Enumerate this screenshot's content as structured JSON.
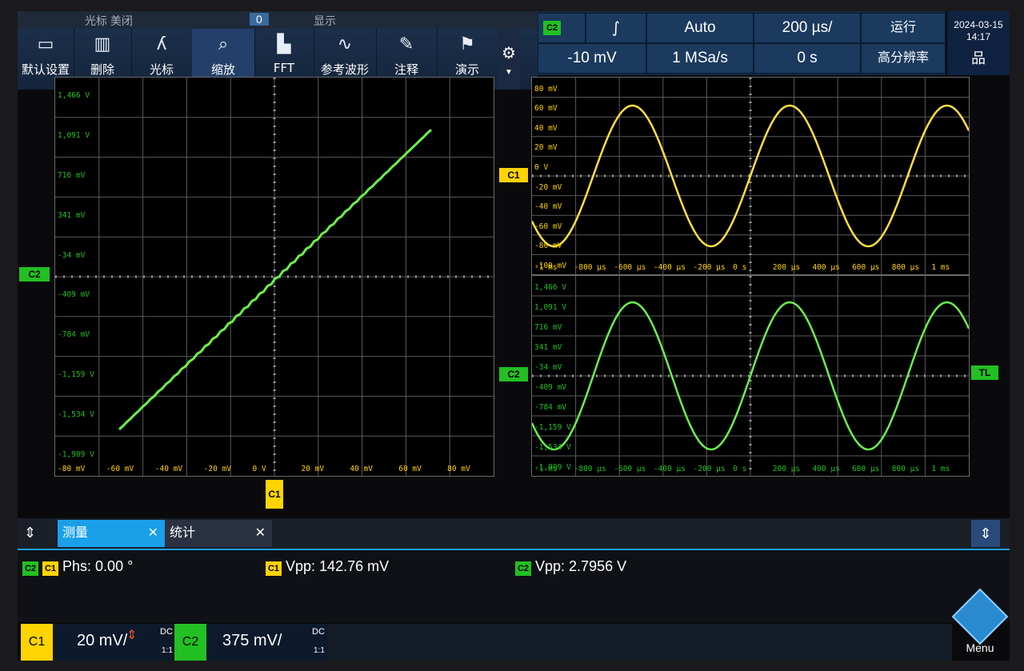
{
  "top_fragment": {
    "left": "光标 美闭",
    "box": "0",
    "mid": "显示"
  },
  "toolbar": {
    "buttons": [
      "默认设置",
      "删除",
      "光标",
      "缩放",
      "FFT",
      "参考波形",
      "注释",
      "演示"
    ]
  },
  "header": {
    "trigger_source": "C2",
    "trigger_level": "-10 mV",
    "trigger_mode": "Auto",
    "sample_rate": "1 MSa/s",
    "timebase": "200 µs/",
    "horizontal_position": "0 s",
    "run_status": "运行",
    "acquire_mode": "高分辨率",
    "date": "2024-03-15",
    "time": "14:17"
  },
  "colors": {
    "c1": "#ffd400",
    "c2": "#22c022",
    "accent": "#1aa0e8",
    "grid": "#5a5a5a"
  },
  "markers": {
    "c1": "C1",
    "c2": "C2",
    "trigger": "TL"
  },
  "xy_plot": {
    "y_labels": [
      "1,466 V",
      "1,091 V",
      "716 mV",
      "341 mV",
      "-34 mV",
      "-409 mV",
      "-784 mV",
      "-1,159 V",
      "-1,534 V",
      "-1,909 V"
    ],
    "x_labels": [
      "-80 mV",
      "-60 mV",
      "-40 mV",
      "-20 mV",
      "0 V",
      "20 mV",
      "40 mV",
      "60 mV",
      "80 mV"
    ]
  },
  "c1_plot": {
    "y_labels": [
      "80 mV",
      "60 mV",
      "40 mV",
      "20 mV",
      "0 V",
      "-20 mV",
      "-40 mV",
      "-60 mV",
      "-80 mV",
      "-100 mV"
    ],
    "x_labels": [
      "-1 ms",
      "-800 µs",
      "-600 µs",
      "-400 µs",
      "-200 µs",
      "0 s",
      "200 µs",
      "400 µs",
      "600 µs",
      "800 µs",
      "1 ms"
    ]
  },
  "c2_plot": {
    "y_labels": [
      "1,466 V",
      "1,091 V",
      "716 mV",
      "341 mV",
      "-34 mV",
      "-409 mV",
      "-784 mV",
      "-1,159 V",
      "-1,534 V",
      "-1,909 V"
    ],
    "x_labels": [
      "-1 ms",
      "-800 µs",
      "-600 µs",
      "-400 µs",
      "-200 µs",
      "0 s",
      "200 µs",
      "400 µs",
      "600 µs",
      "800 µs",
      "1 ms"
    ]
  },
  "tabs": [
    "测量",
    "统计"
  ],
  "measurements": [
    {
      "ch_a": "C2",
      "ch_b": "C1",
      "text": "Phs: 0.00 °"
    },
    {
      "ch_a": "C1",
      "text": "Vpp: 142.76 mV"
    },
    {
      "ch_a": "C2",
      "text": "Vpp: 2.7956 V"
    }
  ],
  "channels": [
    {
      "name": "C1",
      "scale": "20 mV/",
      "coupling": "DC",
      "probe": "1:1"
    },
    {
      "name": "C2",
      "scale": "375 mV/",
      "coupling": "DC",
      "probe": "1:1"
    }
  ],
  "menu_label": "Menu"
}
